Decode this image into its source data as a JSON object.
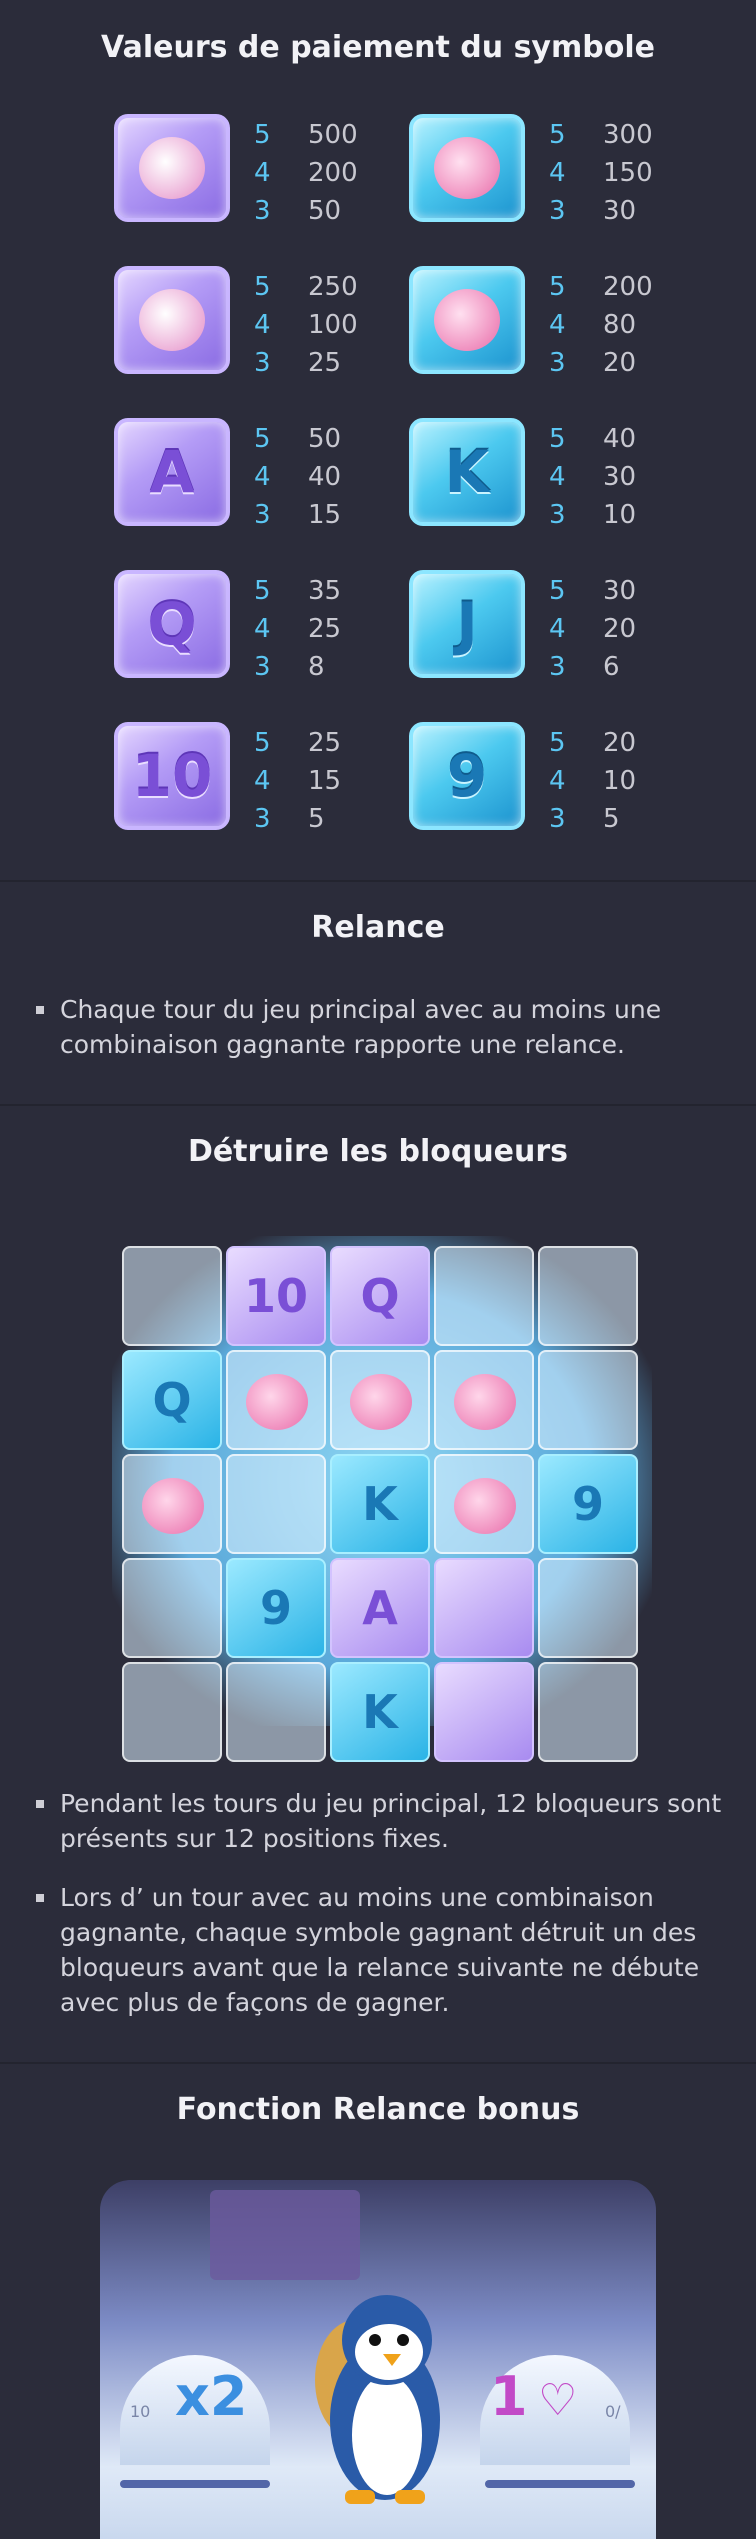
{
  "paytable": {
    "title": "Valeurs de paiement du symbole",
    "symbols": [
      {
        "id": "penguin",
        "color": "purple",
        "glyph": "",
        "rows": [
          {
            "count": "5",
            "value": "500"
          },
          {
            "count": "4",
            "value": "200"
          },
          {
            "count": "3",
            "value": "50"
          }
        ]
      },
      {
        "id": "pink-seal",
        "color": "blue",
        "glyph": "",
        "rows": [
          {
            "count": "5",
            "value": "300"
          },
          {
            "count": "4",
            "value": "150"
          },
          {
            "count": "3",
            "value": "30"
          }
        ]
      },
      {
        "id": "squid",
        "color": "purple",
        "glyph": "",
        "rows": [
          {
            "count": "5",
            "value": "250"
          },
          {
            "count": "4",
            "value": "100"
          },
          {
            "count": "3",
            "value": "25"
          }
        ]
      },
      {
        "id": "fish",
        "color": "blue",
        "glyph": "",
        "rows": [
          {
            "count": "5",
            "value": "200"
          },
          {
            "count": "4",
            "value": "80"
          },
          {
            "count": "3",
            "value": "20"
          }
        ]
      },
      {
        "id": "A",
        "color": "purple",
        "glyph": "A",
        "rows": [
          {
            "count": "5",
            "value": "50"
          },
          {
            "count": "4",
            "value": "40"
          },
          {
            "count": "3",
            "value": "15"
          }
        ]
      },
      {
        "id": "K",
        "color": "blue",
        "glyph": "K",
        "rows": [
          {
            "count": "5",
            "value": "40"
          },
          {
            "count": "4",
            "value": "30"
          },
          {
            "count": "3",
            "value": "10"
          }
        ]
      },
      {
        "id": "Q",
        "color": "purple",
        "glyph": "Q",
        "rows": [
          {
            "count": "5",
            "value": "35"
          },
          {
            "count": "4",
            "value": "25"
          },
          {
            "count": "3",
            "value": "8"
          }
        ]
      },
      {
        "id": "J",
        "color": "blue",
        "glyph": "J",
        "rows": [
          {
            "count": "5",
            "value": "30"
          },
          {
            "count": "4",
            "value": "20"
          },
          {
            "count": "3",
            "value": "6"
          }
        ]
      },
      {
        "id": "10",
        "color": "purple",
        "glyph": "10",
        "rows": [
          {
            "count": "5",
            "value": "25"
          },
          {
            "count": "4",
            "value": "15"
          },
          {
            "count": "3",
            "value": "5"
          }
        ]
      },
      {
        "id": "9",
        "color": "blue",
        "glyph": "9",
        "rows": [
          {
            "count": "5",
            "value": "20"
          },
          {
            "count": "4",
            "value": "10"
          },
          {
            "count": "3",
            "value": "5"
          }
        ]
      }
    ]
  },
  "relance": {
    "title": "Relance",
    "bullets": [
      "Chaque tour du jeu principal avec au moins une combinaison gagnante rapporte une relance."
    ]
  },
  "blockers": {
    "title": "Détruire les bloqueurs",
    "board": [
      [
        "ice",
        "10",
        "Q",
        "ice",
        "ice"
      ],
      [
        "Q",
        "fish",
        "fish",
        "fish",
        "ice"
      ],
      [
        "fish",
        "ice",
        "K",
        "fish",
        "9"
      ],
      [
        "ice",
        "9",
        "A",
        "purple",
        "ice"
      ],
      [
        "ice",
        "ice",
        "K",
        "purple",
        "ice"
      ]
    ],
    "bullets": [
      "Pendant les tours du jeu principal, 12 bloqueurs sont présents sur 12 positions fixes.",
      "Lors d’ un tour avec au moins une combinaison gagnante, chaque symbole gagnant détruit un des bloqueurs avant que la relance suivante ne débute avec plus de façons de gagner."
    ]
  },
  "bonus": {
    "title": "Fonction Relance bonus",
    "left_multiplier": "x2",
    "right_counter": "1",
    "left_small": "10",
    "right_small": "0/"
  },
  "colors": {
    "background": "#2b2c3a",
    "count": "#5cc6f2",
    "purple_tile": "#a88bf0",
    "blue_tile": "#2ab3e6"
  }
}
